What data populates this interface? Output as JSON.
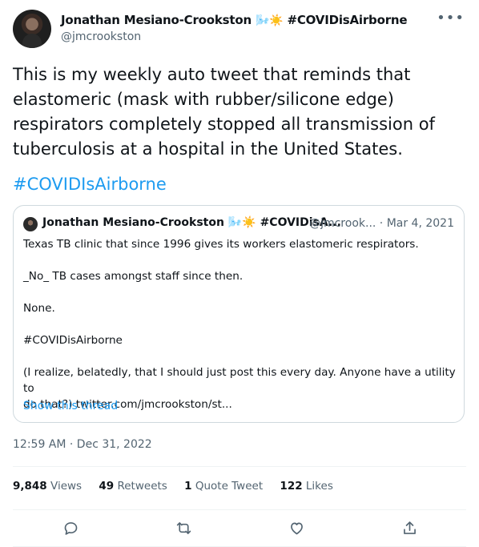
{
  "author": {
    "name": "Jonathan Mesiano-Crookston",
    "emoji": "🌬️☀️",
    "name_suffix": "#COVIDisAirborne",
    "handle": "@jmcrookston"
  },
  "tweet": {
    "text": "This is my weekly auto tweet that reminds that\nelastomeric (mask with rubber/silicone edge)\nrespirators completely stopped all transmission of\ntuberculosis at a hospital in the United States.",
    "hashtag": "#COVIDIsAirborne",
    "timestamp": "12:59 AM · Dec 31, 2022"
  },
  "quote": {
    "name": "Jonathan Mesiano-Crookston",
    "emoji": "🌬️☀️",
    "name_suffix": "#COVIDisA...",
    "handle": "@jmcrook...",
    "date": "· Mar 4, 2021",
    "paragraphs": [
      "Texas TB clinic that since 1996 gives its workers elastomeric respirators.",
      "_No_ TB cases amongst staff since then.",
      "None.",
      "#COVIDisAirborne",
      "(I realize, belatedly, that I should just post this every day. Anyone have a utility to\ndo that?) twitter.com/jmcrookston/st..."
    ],
    "show_thread": "Show this thread"
  },
  "stats": [
    {
      "count": "9,848",
      "label": "Views"
    },
    {
      "count": "49",
      "label": "Retweets"
    },
    {
      "count": "1",
      "label": "Quote Tweet"
    },
    {
      "count": "122",
      "label": "Likes"
    }
  ],
  "icons": {
    "more": "more-icon",
    "reply": "reply-icon",
    "retweet": "retweet-icon",
    "like": "heart-icon",
    "share": "share-icon"
  },
  "colors": {
    "accent": "#1d9bf0",
    "secondary_text": "#536471",
    "border": "#cfd9de"
  }
}
